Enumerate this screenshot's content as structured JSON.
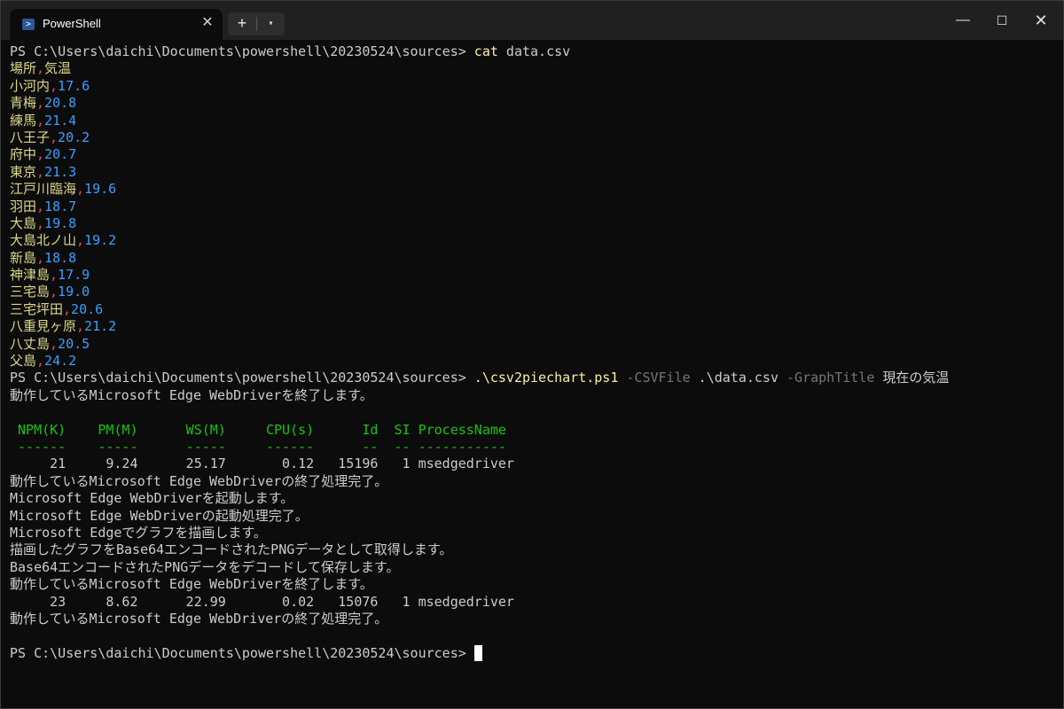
{
  "window": {
    "tab_title": "PowerShell",
    "tab_icon": "powershell-icon",
    "tab_close": "✕",
    "new_tab": "+",
    "dropdown": "⌄",
    "minimize": "—",
    "maximize": "☐",
    "close": "✕"
  },
  "terminal": {
    "prompt": "PS C:\\Users\\daichi\\Documents\\powershell\\20230524\\sources> ",
    "cmd1_name": "cat",
    "cmd1_arg": " data.csv",
    "csv_header": [
      "場所",
      "気温"
    ],
    "csv_rows": [
      [
        "小河内",
        "17.6"
      ],
      [
        "青梅",
        "20.8"
      ],
      [
        "練馬",
        "21.4"
      ],
      [
        "八王子",
        "20.2"
      ],
      [
        "府中",
        "20.7"
      ],
      [
        "東京",
        "21.3"
      ],
      [
        "江戸川臨海",
        "19.6"
      ],
      [
        "羽田",
        "18.7"
      ],
      [
        "大島",
        "19.8"
      ],
      [
        "大島北ノ山",
        "19.2"
      ],
      [
        "新島",
        "18.8"
      ],
      [
        "神津島",
        "17.9"
      ],
      [
        "三宅島",
        "19.0"
      ],
      [
        "三宅坪田",
        "20.6"
      ],
      [
        "八重見ヶ原",
        "21.2"
      ],
      [
        "八丈島",
        "20.5"
      ],
      [
        "父島",
        "24.2"
      ]
    ],
    "cmd2_script": ".\\csv2piechart.ps1",
    "cmd2_param1": " -CSVFile",
    "cmd2_value1": " .\\data.csv",
    "cmd2_param2": " -GraphTitle",
    "cmd2_value2": " 現在の気温",
    "msg_stopping": "動作しているMicrosoft Edge WebDriverを終了します。",
    "table_header": " NPM(K)    PM(M)      WS(M)     CPU(s)      Id  SI ProcessName",
    "table_rule": " ------    -----      -----     ------      --  -- -----------",
    "proc1": "     21     9.24      25.17       0.12   15196   1 msedgedriver",
    "msg_stop_done": "動作しているMicrosoft Edge WebDriverの終了処理完了。",
    "msg_start": "Microsoft Edge WebDriverを起動します。",
    "msg_start_done": "Microsoft Edge WebDriverの起動処理完了。",
    "msg_draw": "Microsoft Edgeでグラフを描画します。",
    "msg_capture": "描画したグラフをBase64エンコードされたPNGデータとして取得します。",
    "msg_decode": "Base64エンコードされたPNGデータをデコードして保存します。",
    "msg_stopping2": "動作しているMicrosoft Edge WebDriverを終了します。",
    "proc2": "     23     8.62      22.99       0.02   15076   1 msedgedriver",
    "msg_stop_done2": "動作しているMicrosoft Edge WebDriverの終了処理完了。"
  }
}
